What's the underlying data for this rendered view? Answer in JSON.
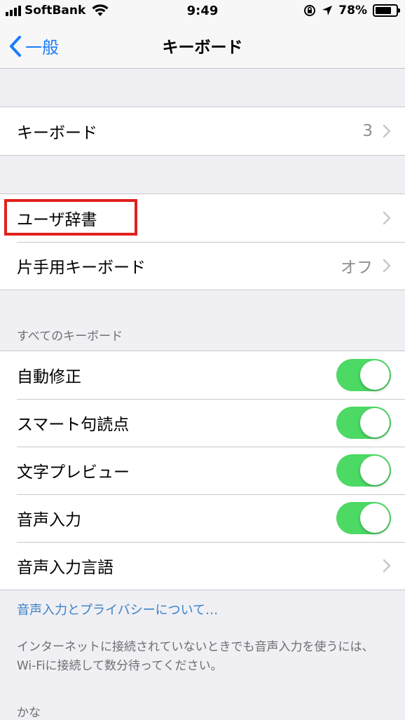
{
  "status_bar": {
    "carrier": "SoftBank",
    "time": "9:49",
    "battery": "78%",
    "battery_level": 0.78
  },
  "nav": {
    "back_label": "一般",
    "title": "キーボード"
  },
  "groups": {
    "keyboards": {
      "label": "キーボード",
      "value": "3"
    },
    "user_dictionary": {
      "label": "ユーザ辞書"
    },
    "one_handed": {
      "label": "片手用キーボード",
      "value": "オフ"
    }
  },
  "all_keyboards": {
    "header": "すべてのキーボード",
    "auto_correct": {
      "label": "自動修正",
      "on": true
    },
    "smart_punctuation": {
      "label": "スマート句読点",
      "on": true
    },
    "character_preview": {
      "label": "文字プレビュー",
      "on": true
    },
    "dictation": {
      "label": "音声入力",
      "on": true
    },
    "dictation_languages": {
      "label": "音声入力言語"
    }
  },
  "footer": {
    "privacy_link": "音声入力とプライバシーについて…",
    "note": "インターネットに接続されていないときでも音声入力を使うには、Wi-Fiに接続して数分待ってください。",
    "next_header": "かな"
  },
  "colors": {
    "accent": "#1a7cf9",
    "toggle_on": "#4cd964",
    "highlight": "#e0211d"
  }
}
